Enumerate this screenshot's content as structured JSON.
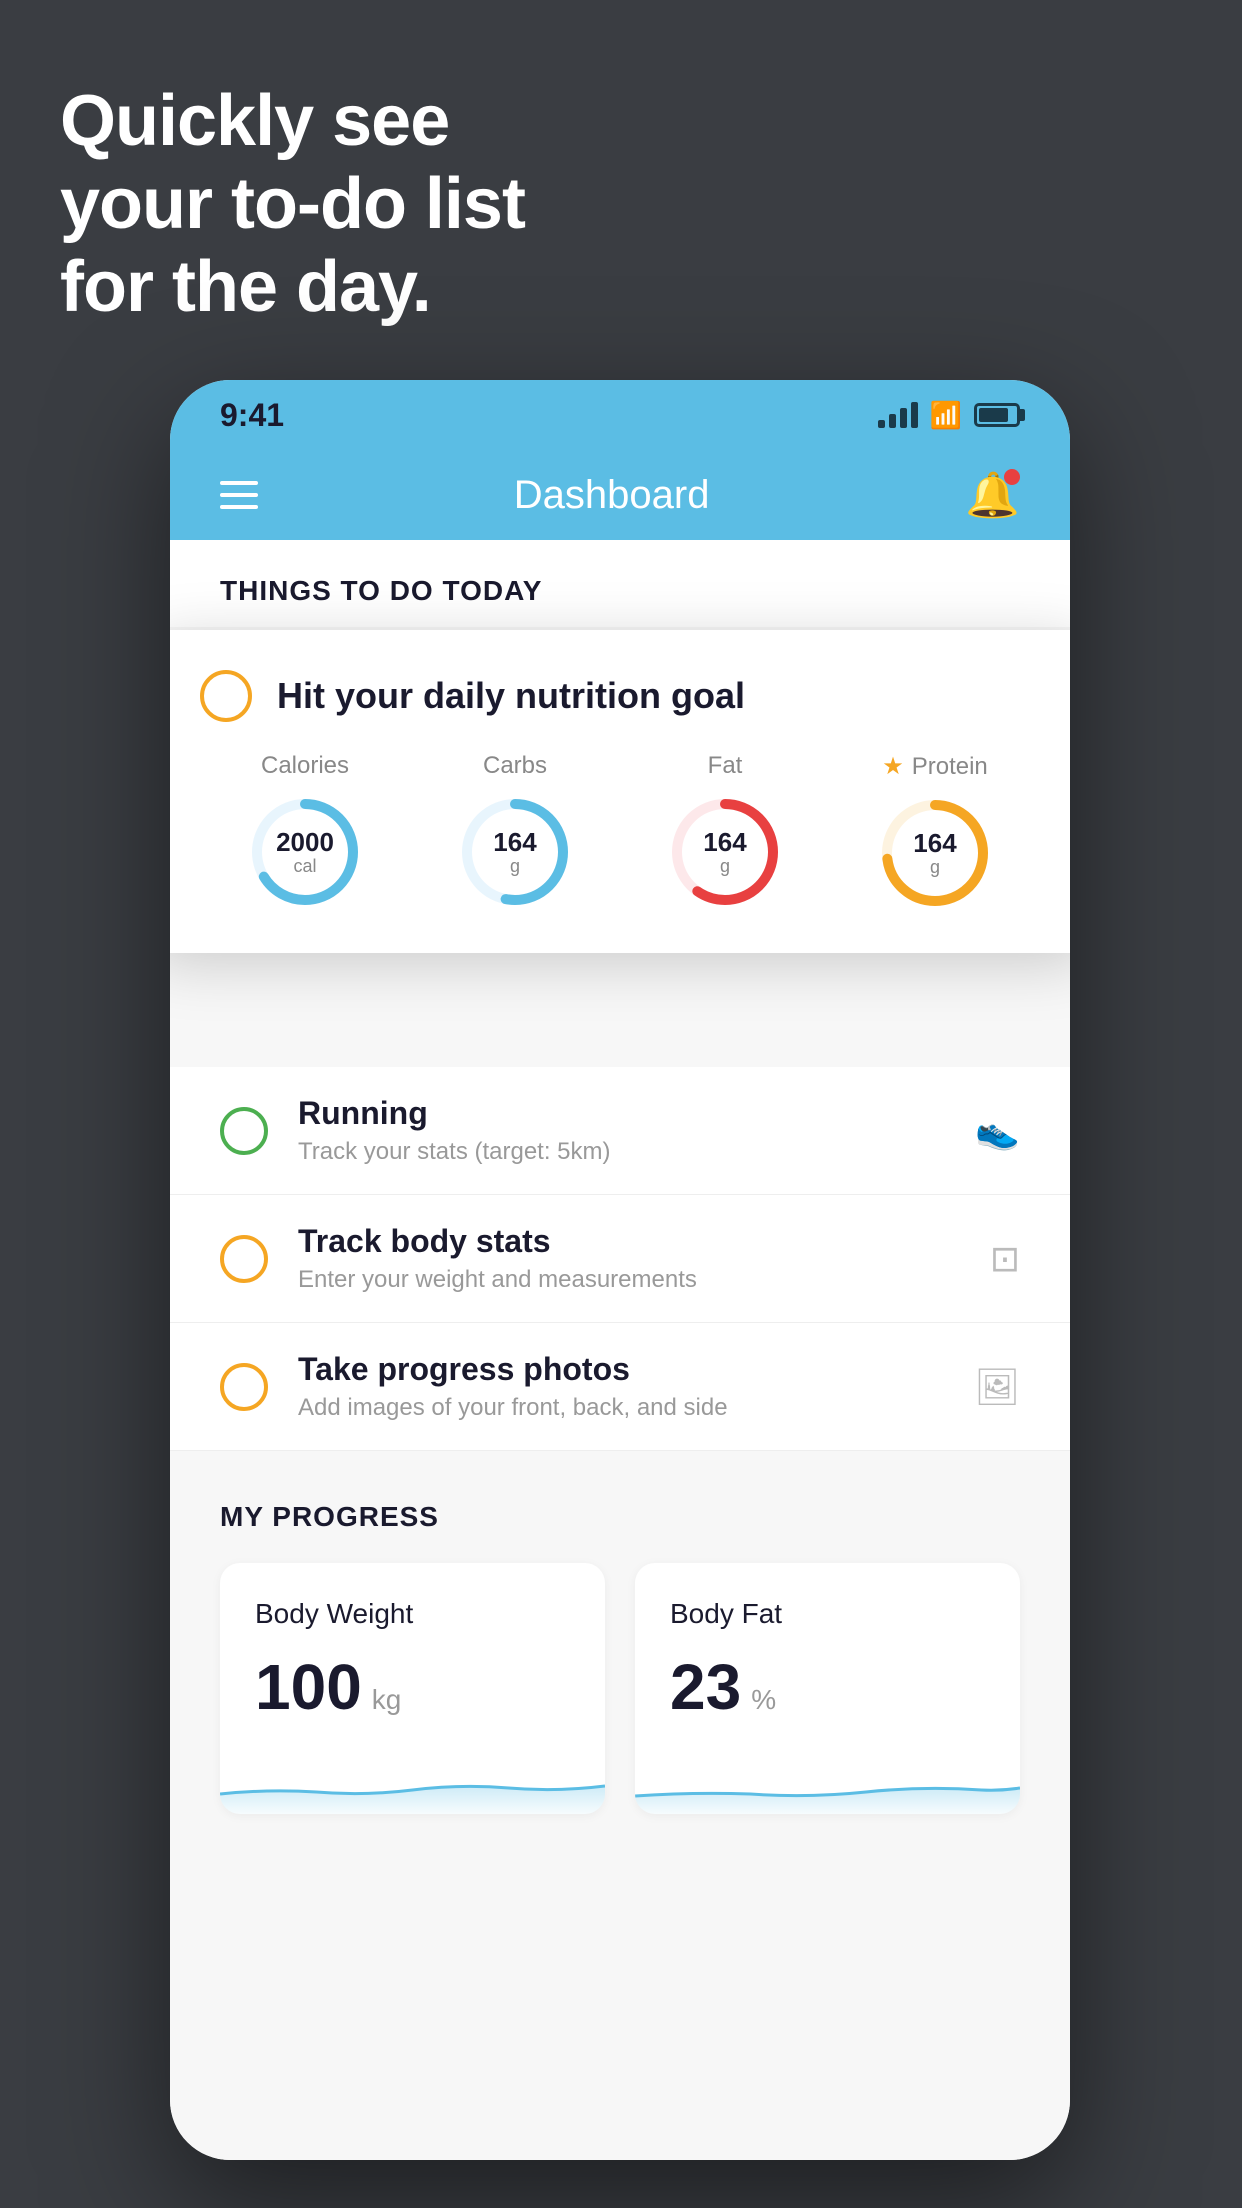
{
  "hero": {
    "line1": "Quickly see",
    "line2": "your to-do list",
    "line3": "for the day."
  },
  "status_bar": {
    "time": "9:41"
  },
  "nav": {
    "title": "Dashboard"
  },
  "things_section": {
    "header": "THINGS TO DO TODAY"
  },
  "floating_card": {
    "circle_color": "#f5a623",
    "title": "Hit your daily nutrition goal",
    "nutrients": [
      {
        "label": "Calories",
        "value": "2000",
        "unit": "cal",
        "color": "#5bbde4",
        "starred": false
      },
      {
        "label": "Carbs",
        "value": "164",
        "unit": "g",
        "color": "#5bbde4",
        "starred": false
      },
      {
        "label": "Fat",
        "value": "164",
        "unit": "g",
        "color": "#e84040",
        "starred": false
      },
      {
        "label": "Protein",
        "value": "164",
        "unit": "g",
        "color": "#f5a623",
        "starred": true
      }
    ]
  },
  "todo_items": [
    {
      "circle_color": "green",
      "title": "Running",
      "subtitle": "Track your stats (target: 5km)",
      "icon": "👟"
    },
    {
      "circle_color": "yellow",
      "title": "Track body stats",
      "subtitle": "Enter your weight and measurements",
      "icon": "⚖️"
    },
    {
      "circle_color": "yellow",
      "title": "Take progress photos",
      "subtitle": "Add images of your front, back, and side",
      "icon": "🖼️"
    }
  ],
  "progress_section": {
    "header": "MY PROGRESS",
    "cards": [
      {
        "title": "Body Weight",
        "value": "100",
        "unit": "kg"
      },
      {
        "title": "Body Fat",
        "value": "23",
        "unit": "%"
      }
    ]
  }
}
